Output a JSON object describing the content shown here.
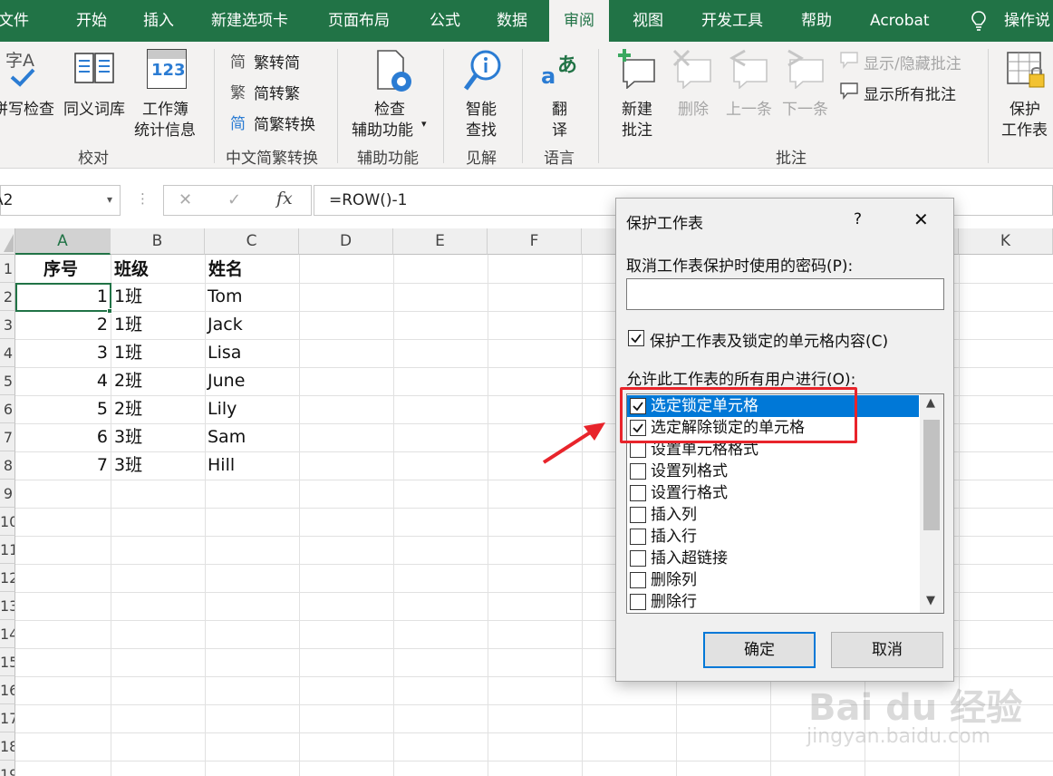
{
  "tabs": [
    {
      "label": "文件",
      "active": false
    },
    {
      "label": "开始",
      "active": false
    },
    {
      "label": "插入",
      "active": false
    },
    {
      "label": "新建选项卡",
      "active": false
    },
    {
      "label": "页面布局",
      "active": false
    },
    {
      "label": "公式",
      "active": false
    },
    {
      "label": "数据",
      "active": false
    },
    {
      "label": "审阅",
      "active": true
    },
    {
      "label": "视图",
      "active": false
    },
    {
      "label": "开发工具",
      "active": false
    },
    {
      "label": "帮助",
      "active": false
    },
    {
      "label": "Acrobat",
      "active": false
    },
    {
      "label": "操作说",
      "active": false
    }
  ],
  "ribbon": {
    "proofing": {
      "spelling": "拼写检查",
      "thesaurus": "同义词库",
      "stats_line1": "工作簿",
      "stats_line2": "统计信息",
      "group": "校对",
      "spelling_icon_text": "字A",
      "stats_icon_text": "123"
    },
    "chinese": {
      "trad_to_simp": "繁转简",
      "simp_to_trad": "简转繁",
      "convert": "简繁转换",
      "group": "中文简繁转换",
      "glyph_1": "简",
      "glyph_2": "繁",
      "glyph_3": "简"
    },
    "accessibility": {
      "check_line1": "检查",
      "check_line2": "辅助功能",
      "group": "辅助功能"
    },
    "insights": {
      "smart_line1": "智能",
      "smart_line2": "查找",
      "group": "见解"
    },
    "language": {
      "translate_line1": "翻",
      "translate_line2": "译",
      "group": "语言",
      "icon_text_a": "a",
      "icon_text_b": "あ"
    },
    "comments": {
      "new_line1": "新建",
      "new_line2": "批注",
      "delete": "删除",
      "prev": "上一条",
      "next": "下一条",
      "show_hide": "显示/隐藏批注",
      "show_all": "显示所有批注",
      "group": "批注"
    },
    "protect": {
      "line1": "保护",
      "line2": "工作表"
    }
  },
  "formula_bar": {
    "name_box": "A2",
    "cancel_glyph": "✕",
    "enter_glyph": "✓",
    "fx_label": "fx",
    "formula": "=ROW()-1"
  },
  "sheet": {
    "columns": [
      "A",
      "B",
      "C",
      "D",
      "E",
      "F",
      "K"
    ],
    "selected_column": "A",
    "row_numbers": [
      "1",
      "2",
      "3",
      "4",
      "5",
      "6",
      "7",
      "8",
      "9",
      "10",
      "11",
      "12",
      "13",
      "14",
      "15",
      "16",
      "17",
      "18",
      "19"
    ],
    "headers": [
      "序号",
      "班级",
      "姓名"
    ],
    "rows": [
      [
        "1",
        "1班",
        "Tom"
      ],
      [
        "2",
        "1班",
        "Jack"
      ],
      [
        "3",
        "1班",
        "Lisa"
      ],
      [
        "4",
        "2班",
        "June"
      ],
      [
        "5",
        "2班",
        "Lily"
      ],
      [
        "6",
        "3班",
        "Sam"
      ],
      [
        "7",
        "3班",
        "Hill"
      ]
    ]
  },
  "dialog": {
    "title": "保护工作表",
    "help": "?",
    "close": "✕",
    "password_label": "取消工作表保护时使用的密码(P):",
    "password_value": "",
    "protect_label": "保护工作表及锁定的单元格内容(C)",
    "protect_checked": true,
    "allow_label": "允许此工作表的所有用户进行(O):",
    "options": [
      {
        "label": "选定锁定单元格",
        "checked": true,
        "selected": true
      },
      {
        "label": "选定解除锁定的单元格",
        "checked": true,
        "selected": false
      },
      {
        "label": "设置单元格格式",
        "checked": false,
        "selected": false
      },
      {
        "label": "设置列格式",
        "checked": false,
        "selected": false
      },
      {
        "label": "设置行格式",
        "checked": false,
        "selected": false
      },
      {
        "label": "插入列",
        "checked": false,
        "selected": false
      },
      {
        "label": "插入行",
        "checked": false,
        "selected": false
      },
      {
        "label": "插入超链接",
        "checked": false,
        "selected": false
      },
      {
        "label": "删除列",
        "checked": false,
        "selected": false
      },
      {
        "label": "删除行",
        "checked": false,
        "selected": false
      }
    ],
    "ok": "确定",
    "cancel": "取消"
  },
  "watermark": {
    "line1": "Bai du 经验",
    "line2": "jingyan.baidu.com"
  },
  "colors": {
    "excel_green": "#217346",
    "highlight_red": "#e8242b",
    "selection_blue": "#0078d7"
  }
}
